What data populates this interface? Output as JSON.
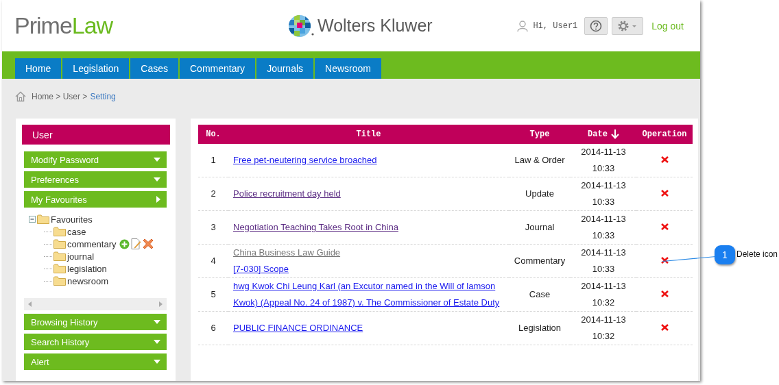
{
  "header": {
    "brand": {
      "first": "Prime",
      "second": "Law"
    },
    "partner_logo": "Wolters Kluwer",
    "greeting": "Hi, User1",
    "logout": "Log out"
  },
  "nav": {
    "tabs": [
      {
        "label": "Home"
      },
      {
        "label": "Legislation"
      },
      {
        "label": "Cases"
      },
      {
        "label": "Commentary"
      },
      {
        "label": "Journals"
      },
      {
        "label": "Newsroom"
      }
    ]
  },
  "breadcrumb": {
    "path": "Home > User >",
    "current": "Setting"
  },
  "sidebar": {
    "title": "User",
    "sections": [
      {
        "label": "Modify Password",
        "expanded": false
      },
      {
        "label": "Preferences",
        "expanded": false
      },
      {
        "label": "My Favourites",
        "expanded": true,
        "tree": {
          "label": "Favourites",
          "expanded": true,
          "children": [
            {
              "label": "case",
              "show_actions": false
            },
            {
              "label": "commentary",
              "show_actions": true
            },
            {
              "label": "journal",
              "show_actions": false
            },
            {
              "label": "legislation",
              "show_actions": false
            },
            {
              "label": "newsroom",
              "show_actions": false
            }
          ]
        }
      },
      {
        "label": "Browsing History",
        "expanded": false
      },
      {
        "label": "Search History",
        "expanded": false
      },
      {
        "label": "Alert",
        "expanded": false
      }
    ]
  },
  "table": {
    "columns": [
      {
        "label": "No."
      },
      {
        "label": "Title"
      },
      {
        "label": "Type"
      },
      {
        "label": "Date",
        "sorted_descending": true
      },
      {
        "label": "Operation"
      }
    ],
    "rows": [
      {
        "no": "1",
        "links": [
          {
            "text": "Free pet-neutering service broached",
            "kind": "unvisited"
          }
        ],
        "type": "Law & Order",
        "date": "2014-11-13",
        "time": "10:33"
      },
      {
        "no": "2",
        "links": [
          {
            "text": "Police recruitment day held",
            "kind": "visited"
          }
        ],
        "type": "Update",
        "date": "2014-11-13",
        "time": "10:33"
      },
      {
        "no": "3",
        "links": [
          {
            "text": "Negotiation Teaching Takes Root in China",
            "kind": "visited"
          }
        ],
        "type": "Journal",
        "date": "2014-11-13",
        "time": "10:33"
      },
      {
        "no": "4",
        "links": [
          {
            "text": "China Business Law Guide",
            "kind": "muted"
          },
          {
            "text": "[7-030] Scope",
            "kind": "unvisited"
          }
        ],
        "type": "Commentary",
        "date": "2014-11-13",
        "time": "10:33"
      },
      {
        "no": "5",
        "links": [
          {
            "text": "hwg Kwok Chi Leung Karl (an Excutor named in the Will of lamson Kwok) (Appeal No. 24 of 1987) v. The Commissioner of Estate Duty",
            "kind": "unvisited"
          }
        ],
        "type": "Case",
        "date": "2014-11-13",
        "time": "10:32"
      },
      {
        "no": "6",
        "links": [
          {
            "text": "PUBLIC FINANCE ORDINANCE",
            "kind": "unvisited"
          }
        ],
        "type": "Legislation",
        "date": "2014-11-13",
        "time": "10:32"
      }
    ]
  },
  "callout": {
    "number": "1",
    "label": "Delete icon"
  }
}
